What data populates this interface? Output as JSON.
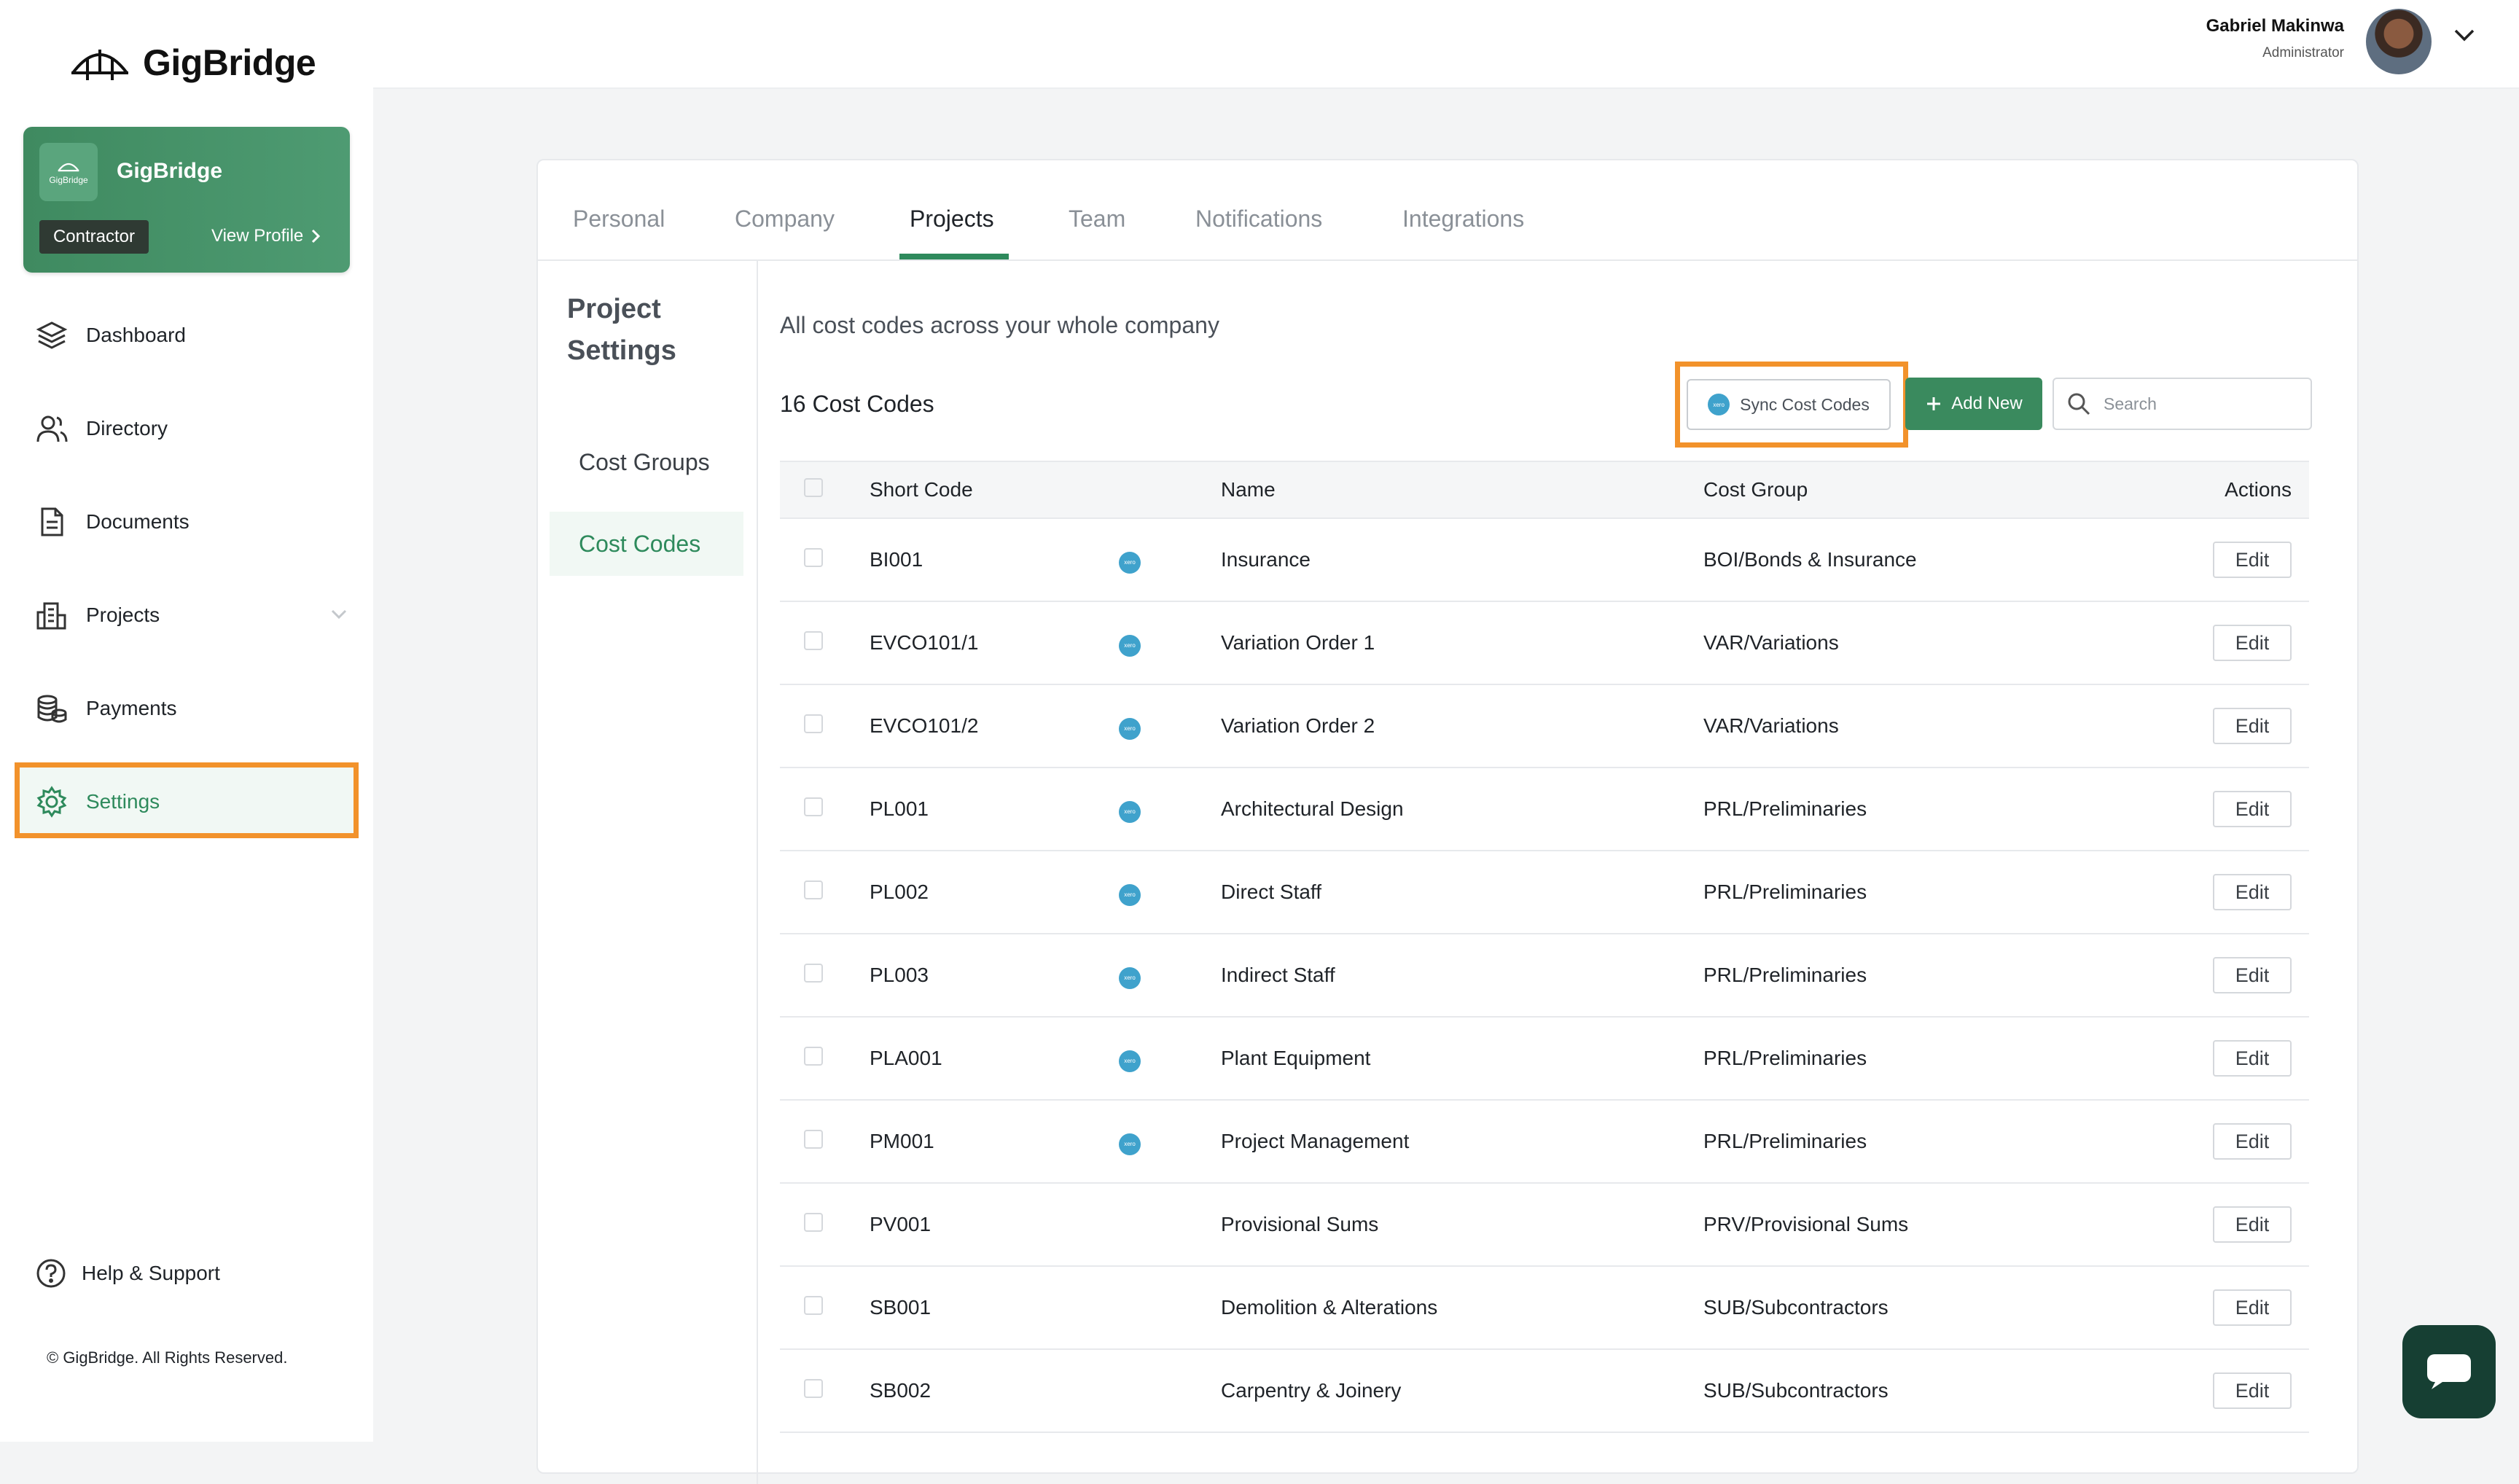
{
  "app": {
    "name": "GigBridge"
  },
  "profile_card": {
    "logo_text": "GigBridge",
    "name": "GigBridge",
    "role": "Contractor",
    "view_profile": "View Profile"
  },
  "nav": {
    "dashboard": "Dashboard",
    "directory": "Directory",
    "documents": "Documents",
    "projects": "Projects",
    "payments": "Payments",
    "settings": "Settings",
    "help": "Help & Support",
    "copyright": "© GigBridge. All Rights Reserved."
  },
  "user": {
    "name": "Gabriel Makinwa",
    "role": "Administrator"
  },
  "tabs": {
    "personal": "Personal",
    "company": "Company",
    "projects": "Projects",
    "team": "Team",
    "notifications": "Notifications",
    "integrations": "Integrations"
  },
  "settings_menu": {
    "title": "Project Settings",
    "cost_groups": "Cost Groups",
    "cost_codes": "Cost Codes"
  },
  "content": {
    "description": "All cost codes across your whole company",
    "count": "16 Cost Codes",
    "sync_label": "Sync Cost Codes",
    "add_label": "Add New",
    "search_placeholder": "Search"
  },
  "table": {
    "headers": {
      "short_code": "Short Code",
      "name": "Name",
      "cost_group": "Cost Group",
      "actions": "Actions"
    },
    "edit_label": "Edit",
    "rows": [
      {
        "code": "BI001",
        "xero": true,
        "name": "Insurance",
        "group": "BOI/Bonds & Insurance"
      },
      {
        "code": "EVCO101/1",
        "xero": true,
        "name": "Variation Order 1",
        "group": "VAR/Variations"
      },
      {
        "code": "EVCO101/2",
        "xero": true,
        "name": "Variation Order 2",
        "group": "VAR/Variations"
      },
      {
        "code": "PL001",
        "xero": true,
        "name": "Architectural Design",
        "group": "PRL/Preliminaries"
      },
      {
        "code": "PL002",
        "xero": true,
        "name": "Direct Staff",
        "group": "PRL/Preliminaries"
      },
      {
        "code": "PL003",
        "xero": true,
        "name": "Indirect Staff",
        "group": "PRL/Preliminaries"
      },
      {
        "code": "PLA001",
        "xero": true,
        "name": "Plant Equipment",
        "group": "PRL/Preliminaries"
      },
      {
        "code": "PM001",
        "xero": true,
        "name": "Project Management",
        "group": "PRL/Preliminaries"
      },
      {
        "code": "PV001",
        "xero": false,
        "name": "Provisional Sums",
        "group": "PRV/Provisional Sums"
      },
      {
        "code": "SB001",
        "xero": false,
        "name": "Demolition & Alterations",
        "group": "SUB/Subcontractors"
      },
      {
        "code": "SB002",
        "xero": false,
        "name": "Carpentry & Joinery",
        "group": "SUB/Subcontractors"
      }
    ]
  },
  "icons": {
    "logo": "bridge-logo-icon",
    "dashboard": "layers-icon",
    "directory": "users-icon",
    "documents": "document-icon",
    "projects": "building-icon",
    "payments": "coins-icon",
    "settings": "gear-icon",
    "help": "question-icon",
    "chat": "chat-icon"
  },
  "colors": {
    "accent": "#2e8a5c",
    "highlight": "#f2922b",
    "xero": "#3fa2cc",
    "chat": "#163f33"
  }
}
